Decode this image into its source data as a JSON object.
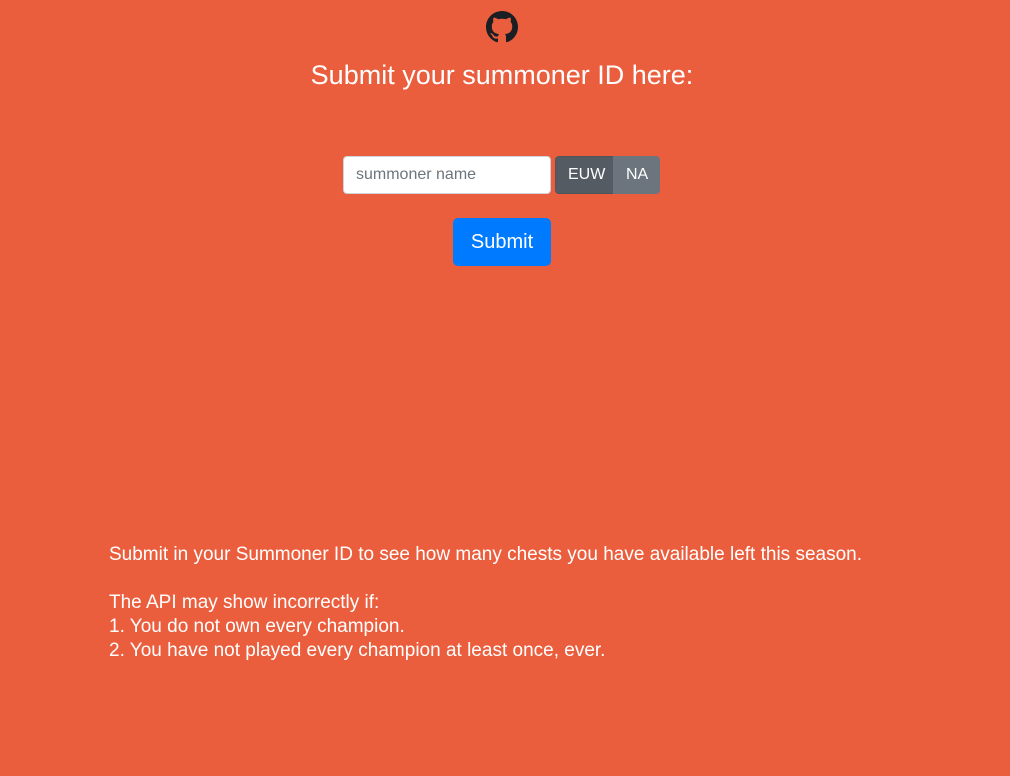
{
  "header": {
    "github_icon": "github-icon"
  },
  "title": "Submit your summoner ID here:",
  "form": {
    "summoner_placeholder": "summoner name",
    "summoner_value": "",
    "regions": [
      {
        "label": "EUW",
        "selected": true
      },
      {
        "label": "NA",
        "selected": false
      }
    ],
    "submit_label": "Submit"
  },
  "info": {
    "intro": "Submit in your Summoner ID to see how many chests you have available left this season.",
    "caveat_heading": "The API may show incorrectly if:",
    "caveats": [
      "1. You do not own every champion.",
      "2. You have not played every champion at least once, ever."
    ]
  },
  "colors": {
    "background": "#eb5e3d",
    "submit": "#007bff",
    "region_active": "#545b62",
    "region_inactive": "#6c757d"
  }
}
